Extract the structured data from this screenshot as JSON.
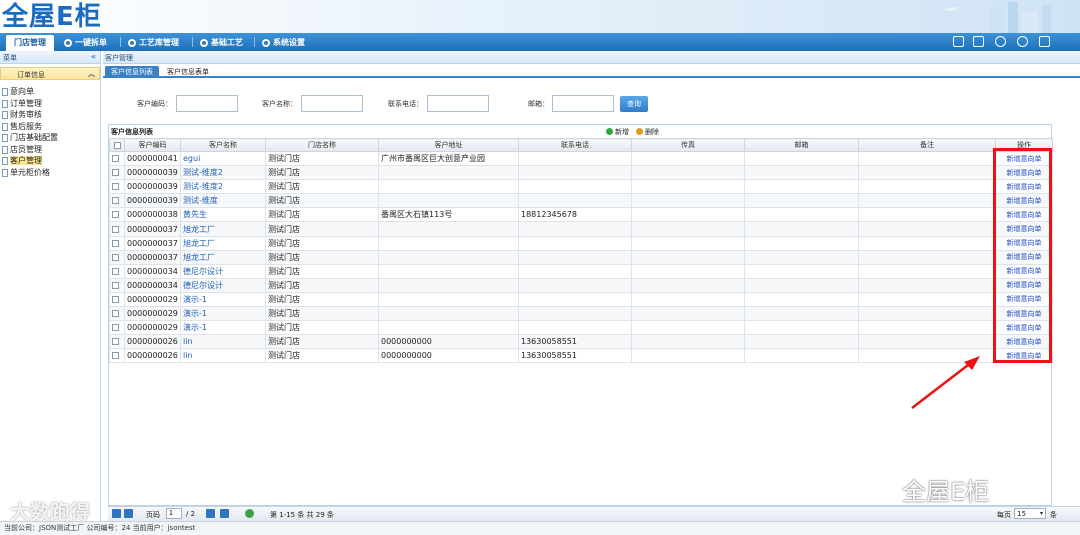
{
  "app": {
    "logo": "全屋E柜"
  },
  "nav": {
    "items": [
      {
        "label": "门店管理",
        "active": true
      },
      {
        "label": "一键拆单"
      },
      {
        "label": "工艺库管理"
      },
      {
        "label": "基础工艺"
      },
      {
        "label": "系统设置"
      }
    ]
  },
  "sidebar": {
    "header": "菜单",
    "group": "订单信息",
    "items": [
      {
        "label": "意向单"
      },
      {
        "label": "订单管理"
      },
      {
        "label": "财务审核"
      },
      {
        "label": "售后服务"
      },
      {
        "label": "门店基础配置"
      },
      {
        "label": "店员管理"
      },
      {
        "label": "客户管理",
        "active": true
      },
      {
        "label": "单元柜价格"
      }
    ]
  },
  "content": {
    "breadcrumb": "客户管理",
    "tabs": [
      {
        "label": "客户信息列表",
        "active": true
      },
      {
        "label": "客户信息表单"
      }
    ]
  },
  "search": {
    "fields": [
      {
        "label": "客户编码：",
        "value": ""
      },
      {
        "label": "客户名称：",
        "value": ""
      },
      {
        "label": "联系电话：",
        "value": ""
      },
      {
        "label": "邮箱：",
        "value": ""
      }
    ],
    "button": "查询"
  },
  "grid": {
    "title": "客户信息列表",
    "add_label": "新增",
    "delete_label": "删除",
    "columns": [
      "客户编码",
      "客户名称",
      "门店名称",
      "客户地址",
      "联系电话",
      "传真",
      "邮箱",
      "备注",
      "操作"
    ],
    "rows": [
      {
        "code": "0000000041",
        "name": "egui",
        "store": "测试门店",
        "address": "广州市番禺区巨大创意产业园",
        "phone": "",
        "fax": "",
        "email": "",
        "note": "",
        "op": "新增意向单"
      },
      {
        "code": "0000000039",
        "name": "测试-维度2",
        "store": "测试门店",
        "address": "",
        "phone": "",
        "fax": "",
        "email": "",
        "note": "",
        "op": "新增意向单"
      },
      {
        "code": "0000000039",
        "name": "测试-维度2",
        "store": "测试门店",
        "address": "",
        "phone": "",
        "fax": "",
        "email": "",
        "note": "",
        "op": "新增意向单"
      },
      {
        "code": "0000000039",
        "name": "测试-维度",
        "store": "测试门店",
        "address": "",
        "phone": "",
        "fax": "",
        "email": "",
        "note": "",
        "op": "新增意向单"
      },
      {
        "code": "0000000038",
        "name": "黄先生",
        "store": "测试门店",
        "address": "番禺区大石镇113号",
        "phone": "18812345678",
        "fax": "",
        "email": "",
        "note": "",
        "op": "新增意向单"
      },
      {
        "code": "0000000037",
        "name": "旭龙工厂",
        "store": "测试门店",
        "address": "",
        "phone": "",
        "fax": "",
        "email": "",
        "note": "",
        "op": "新增意向单"
      },
      {
        "code": "0000000037",
        "name": "旭龙工厂",
        "store": "测试门店",
        "address": "",
        "phone": "",
        "fax": "",
        "email": "",
        "note": "",
        "op": "新增意向单"
      },
      {
        "code": "0000000037",
        "name": "旭龙工厂",
        "store": "测试门店",
        "address": "",
        "phone": "",
        "fax": "",
        "email": "",
        "note": "",
        "op": "新增意向单"
      },
      {
        "code": "0000000034",
        "name": "德尼尔设计",
        "store": "测试门店",
        "address": "",
        "phone": "",
        "fax": "",
        "email": "",
        "note": "",
        "op": "新增意向单"
      },
      {
        "code": "0000000034",
        "name": "德尼尔设计",
        "store": "测试门店",
        "address": "",
        "phone": "",
        "fax": "",
        "email": "",
        "note": "",
        "op": "新增意向单"
      },
      {
        "code": "0000000029",
        "name": "演示-1",
        "store": "测试门店",
        "address": "",
        "phone": "",
        "fax": "",
        "email": "",
        "note": "",
        "op": "新增意向单"
      },
      {
        "code": "0000000029",
        "name": "演示-1",
        "store": "测试门店",
        "address": "",
        "phone": "",
        "fax": "",
        "email": "",
        "note": "",
        "op": "新增意向单"
      },
      {
        "code": "0000000029",
        "name": "演示-1",
        "store": "测试门店",
        "address": "",
        "phone": "",
        "fax": "",
        "email": "",
        "note": "",
        "op": "新增意向单"
      },
      {
        "code": "0000000026",
        "name": "lin",
        "store": "测试门店",
        "address": "0000000000",
        "phone": "13630058551",
        "fax": "",
        "email": "",
        "note": "",
        "op": "新增意向单"
      },
      {
        "code": "0000000026",
        "name": "lin",
        "store": "测试门店",
        "address": "0000000000",
        "phone": "13630058551",
        "fax": "",
        "email": "",
        "note": "",
        "op": "新增意向单"
      }
    ]
  },
  "pager": {
    "page_label": "页码",
    "page": "1",
    "total_pages": "/ 2",
    "summary": "第 1-15 条  共 29 条",
    "per_page_label": "每页",
    "per_page": "15",
    "per_page_unit": "条"
  },
  "status": {
    "text": "当前公司：JSON测试工厂   公司编号：24   当前用户：jsontest"
  },
  "watermark": {
    "left": "大数跑得",
    "right": "全屋E柜"
  },
  "colors": {
    "accent": "#3b82c4",
    "highlight": "#e11111",
    "link": "#1f5fb8"
  }
}
